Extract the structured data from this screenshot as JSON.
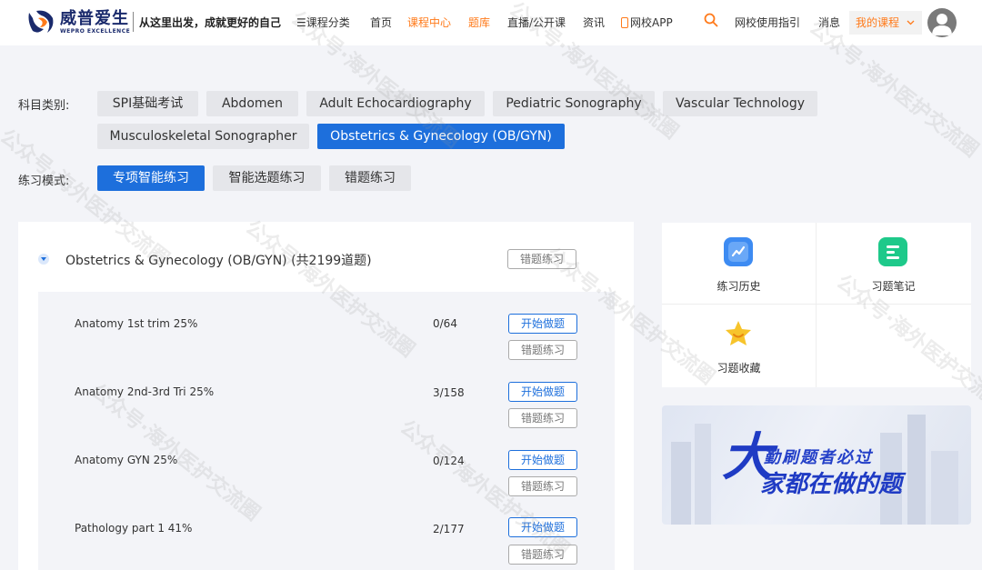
{
  "header": {
    "logo_cn": "威普爱生",
    "logo_en": "WEPRO EXCELLENCE",
    "slogan": "从这里出发，成就更好的自己",
    "nav": {
      "catalog": "☰课程分类",
      "home": "首页",
      "course_center": "课程中心",
      "question_bank": "题库",
      "live": "直播/公开课",
      "news": "资讯",
      "app": "网校APP",
      "guide": "网校使用指引",
      "messages": "消息",
      "my_courses": "我的课程"
    },
    "active_color": "#ff7a1a"
  },
  "filters": {
    "subject_label": "科目类别:",
    "subjects": [
      "SPI基础考试",
      "Abdomen",
      "Adult Echocardiography",
      "Pediatric Sonography",
      "Vascular Technology",
      "Musculoskeletal Sonographer",
      "Obstetrics & Gynecology (OB/GYN)"
    ],
    "selected_subject": "Obstetrics & Gynecology (OB/GYN)",
    "mode_label": "练习模式:",
    "modes": [
      "专项智能练习",
      "智能选题练习",
      "错题练习"
    ],
    "selected_mode": "专项智能练习",
    "accent": "#1d6fdc"
  },
  "section": {
    "title": "Obstetrics & Gynecology (OB/GYN) (共2199道题)",
    "wrong_button": "错题练习",
    "rows": [
      {
        "name": "Anatomy 1st trim 25%",
        "count": "0/64",
        "start": "开始做题",
        "wrong": "错题练习"
      },
      {
        "name": "Anatomy 2nd-3rd Tri 25%",
        "count": "3/158",
        "start": "开始做题",
        "wrong": "错题练习"
      },
      {
        "name": "Anatomy GYN 25%",
        "count": "0/124",
        "start": "开始做题",
        "wrong": "错题练习"
      },
      {
        "name": "Pathology part 1 41%",
        "count": "2/177",
        "start": "开始做题",
        "wrong": "错题练习"
      }
    ]
  },
  "tools": {
    "history": {
      "label": "练习历史",
      "icon": "chart-line-icon",
      "color": "#3d8bf2"
    },
    "notes": {
      "label": "习题笔记",
      "icon": "note-icon",
      "color": "#1ec98a"
    },
    "favorites": {
      "label": "习题收藏",
      "icon": "star-icon",
      "color": "#f5c518"
    }
  },
  "banner": {
    "small": "勤刷题者必过",
    "big_first": "大",
    "big_rest": "家都在做的题"
  },
  "watermark": "公众号·海外医护交流圈"
}
